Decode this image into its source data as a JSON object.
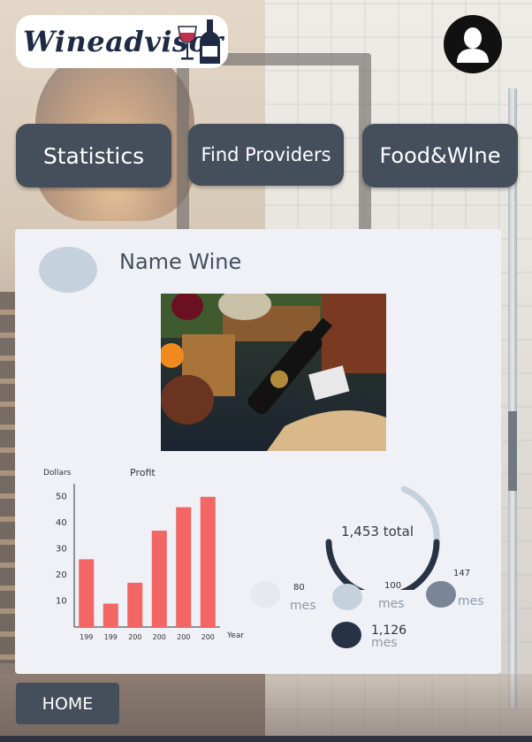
{
  "app": {
    "logo_text": "Wineadvisor",
    "logo_icons": [
      "wine-glass-icon",
      "wine-bottle-icon"
    ]
  },
  "nav": {
    "statistics_label": "Statistics",
    "find_providers_label": "Find Providers",
    "food_wine_label": "Food&WIne"
  },
  "user": {
    "avatar_icon": "user-icon"
  },
  "wine_card": {
    "name": "Name Wine",
    "image_alt": "wine bottle on table with bread and glass"
  },
  "chart_data": {
    "type": "bar",
    "title": "Profit",
    "ylabel": "Dollars",
    "xlabel": "Year",
    "categories": [
      "199",
      "199",
      "200",
      "200",
      "200",
      "200"
    ],
    "values": [
      26,
      9,
      17,
      37,
      46,
      50
    ],
    "yticks": [
      10,
      20,
      30,
      40,
      50
    ],
    "ylim": [
      0,
      55
    ],
    "bar_color": "#f36666",
    "grid": false
  },
  "summary": {
    "total_label": "1,453 total",
    "total_value": 1453,
    "ring_color": "#273245",
    "ring_track_color": "#c6d1de",
    "legend": [
      {
        "value": "80",
        "unit": "mes",
        "color": "#e6e9f0"
      },
      {
        "value": "100",
        "unit": "mes",
        "color": "#c6d1de"
      },
      {
        "value": "147",
        "unit": "mes",
        "color": "#7a8697"
      },
      {
        "value": "1,126",
        "unit": "mes",
        "color": "#273245"
      }
    ]
  },
  "footer": {
    "home_label": "HOME"
  },
  "colors": {
    "button_bg": "#454f5c",
    "card_bg": "#eff1f7",
    "accent_bar": "#f36666"
  }
}
